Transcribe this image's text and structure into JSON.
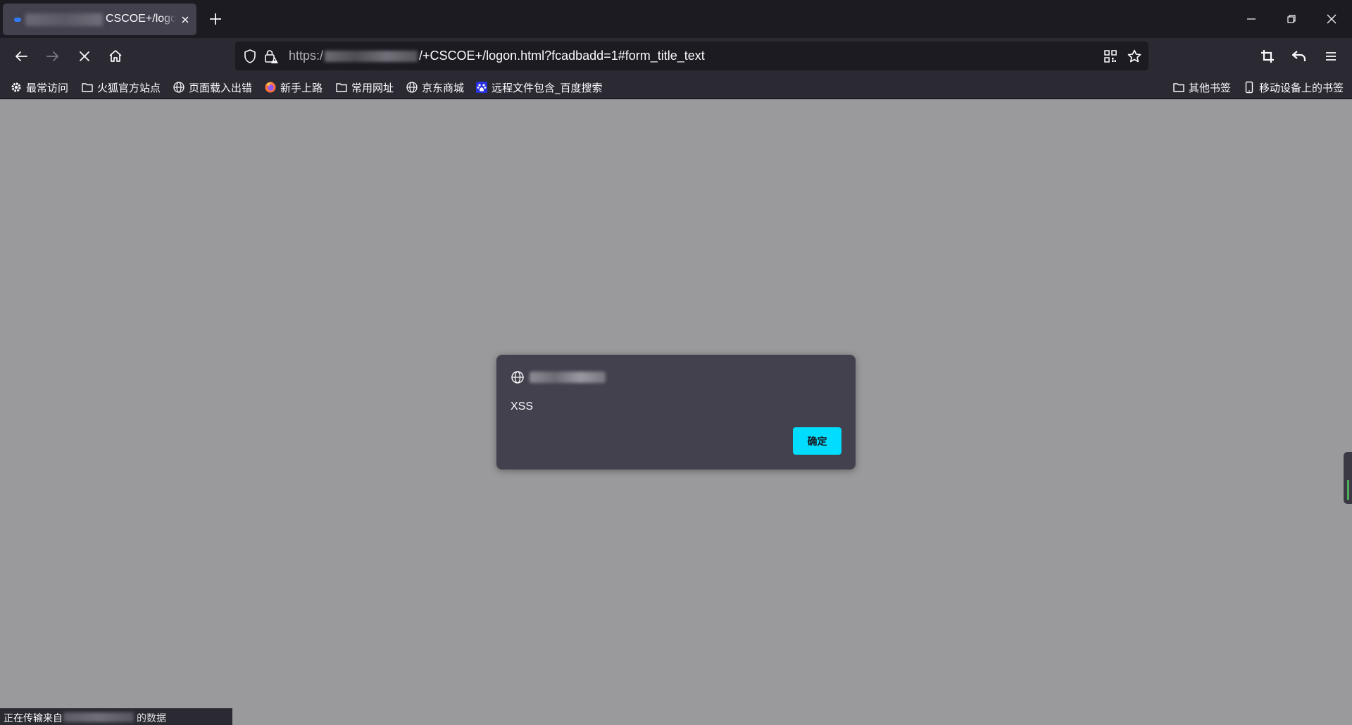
{
  "browser": {
    "tab": {
      "title": "CSCOE+/logon.html",
      "favicon_color": "#2f7cf6"
    },
    "window_controls": [
      "minimize-icon",
      "restore-icon",
      "close-icon"
    ],
    "nav": {
      "back_icon": "arrow-left-icon",
      "forward_icon": "arrow-right-icon",
      "stop_icon": "close-icon",
      "home_icon": "home-icon"
    },
    "url": {
      "scheme": "https:/",
      "path": "/+CSCOE+/logon.html?fcadbadd=1#form_title_text"
    },
    "toolbar_right": [
      "screenshot-icon",
      "undo-icon",
      "menu-icon"
    ],
    "bookmarks": [
      {
        "label": "最常访问",
        "icon": "gear-icon"
      },
      {
        "label": "火狐官方站点",
        "icon": "folder-icon"
      },
      {
        "label": "页面载入出错",
        "icon": "globe-icon"
      },
      {
        "label": "新手上路",
        "icon": "firefox-icon"
      },
      {
        "label": "常用网址",
        "icon": "folder-icon"
      },
      {
        "label": "京东商城",
        "icon": "globe-icon"
      },
      {
        "label": "远程文件包含_百度搜索",
        "icon": "baidu-icon"
      }
    ],
    "bookmarks_right": [
      {
        "label": "其他书签",
        "icon": "folder-icon"
      },
      {
        "label": "移动设备上的书签",
        "icon": "mobile-icon"
      }
    ]
  },
  "dialog": {
    "message": "XSS",
    "ok_label": "确定",
    "ok_color": "#00ddff"
  },
  "status": {
    "text": "正在传输来自",
    "tail": "的数据"
  },
  "colors": {
    "page_overlay": "#9a9a9c",
    "chrome_bg": "#2b2a33",
    "tabstrip_bg": "#1c1b22"
  }
}
